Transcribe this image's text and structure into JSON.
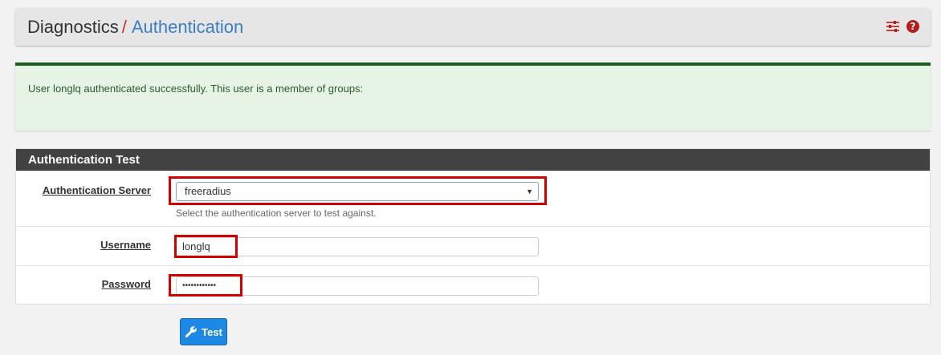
{
  "breadcrumb": {
    "root": "Diagnostics",
    "separator": "/",
    "current": "Authentication"
  },
  "header_icons": [
    "sliders-icon",
    "help-icon"
  ],
  "alert": {
    "message": "User longlq authenticated successfully. This user is a member of groups:"
  },
  "panel": {
    "title": "Authentication Test",
    "fields": {
      "server": {
        "label": "Authentication Server",
        "value": "freeradius",
        "help": "Select the authentication server to test against."
      },
      "username": {
        "label": "Username",
        "value": "longlq"
      },
      "password": {
        "label": "Password",
        "value": "••••••••••••"
      }
    }
  },
  "test_button": {
    "label": "Test",
    "icon": "wrench-icon"
  },
  "colors": {
    "accent_red": "#c9302c",
    "link_blue": "#3a7fc1",
    "success_border": "#1b5e20",
    "success_bg": "#e6f4e6",
    "panel_heading": "#424242",
    "button_blue": "#1e88e5",
    "highlight_red": "#d00000"
  }
}
